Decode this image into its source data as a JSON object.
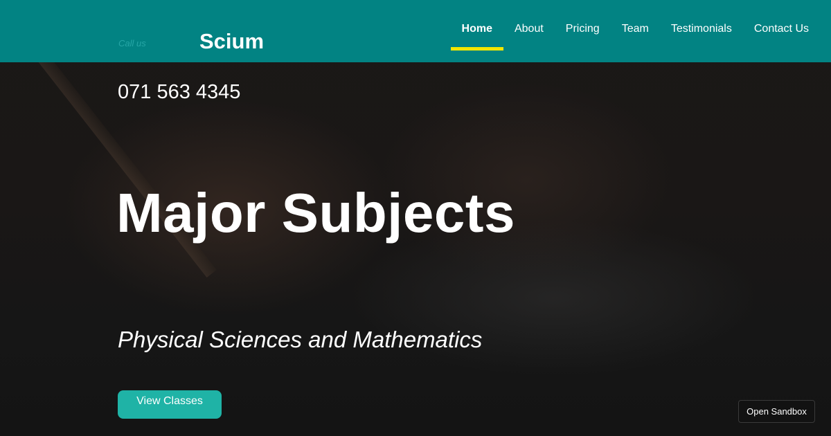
{
  "header": {
    "call_label": "Call us",
    "brand": "Scium"
  },
  "nav": {
    "items": [
      {
        "label": "Home",
        "active": true
      },
      {
        "label": "About"
      },
      {
        "label": "Pricing"
      },
      {
        "label": "Team"
      },
      {
        "label": "Testimonials"
      },
      {
        "label": "Contact Us"
      }
    ]
  },
  "hero": {
    "phone": "071 563 4345",
    "title": "Major Subjects",
    "subtitle": "Physical Sciences and Mathematics",
    "cta_label": "View Classes"
  },
  "sandbox_label": "Open Sandbox",
  "colors": {
    "navbar": "#028383",
    "active_underline": "#f2e600",
    "cta": "#1fb3a6"
  }
}
